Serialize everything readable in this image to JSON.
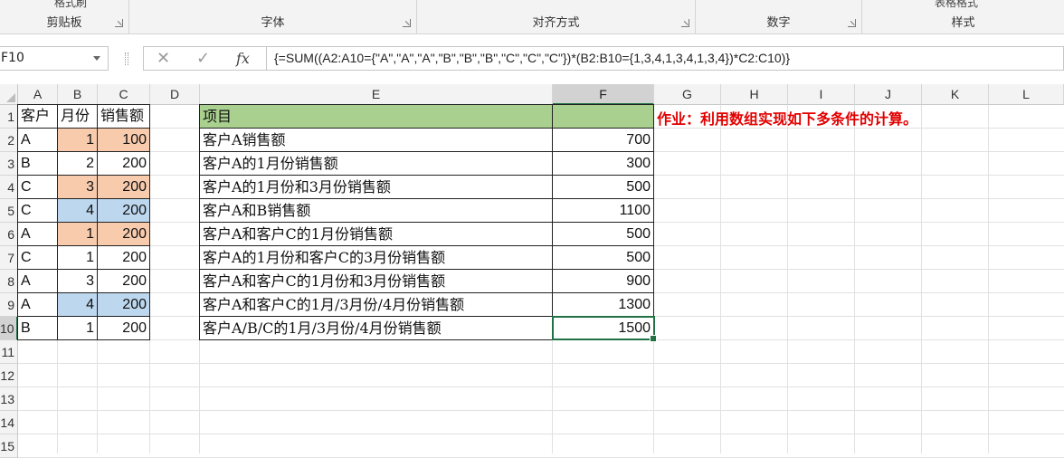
{
  "ribbon": {
    "groups": [
      {
        "label": "剪贴板",
        "top_text": "格式刷"
      },
      {
        "label": "字体"
      },
      {
        "label": "对齐方式"
      },
      {
        "label": "数字"
      },
      {
        "label": "样式",
        "top_text": "表格格式"
      }
    ]
  },
  "formula_bar": {
    "name_box": "F10",
    "cancel_icon": "✕",
    "enter_icon": "✓",
    "fx_label": "fx",
    "formula": "{=SUM((A2:A10={\"A\",\"A\",\"A\",\"B\",\"B\",\"B\",\"C\",\"C\",\"C\"})*(B2:B10={1,3,4,1,3,4,1,3,4})*C2:C10)}"
  },
  "grid": {
    "columns": [
      "A",
      "B",
      "C",
      "D",
      "E",
      "F",
      "G",
      "H",
      "I",
      "J",
      "K",
      "L"
    ],
    "selected_column": "F",
    "rows": [
      "1",
      "2",
      "3",
      "4",
      "5",
      "6",
      "7",
      "8",
      "9",
      "10",
      "11",
      "12",
      "13",
      "14",
      "15"
    ],
    "selected_row": "10"
  },
  "table_left": {
    "headers": [
      "客户",
      "月份",
      "销售额"
    ],
    "rows": [
      {
        "customer": "A",
        "month": "1",
        "sales": "100",
        "month_fill": "orange",
        "sales_fill": "orange"
      },
      {
        "customer": "B",
        "month": "2",
        "sales": "200",
        "month_fill": "",
        "sales_fill": ""
      },
      {
        "customer": "C",
        "month": "3",
        "sales": "200",
        "month_fill": "orange",
        "sales_fill": "orange"
      },
      {
        "customer": "C",
        "month": "4",
        "sales": "200",
        "month_fill": "blue",
        "sales_fill": "blue"
      },
      {
        "customer": "A",
        "month": "1",
        "sales": "200",
        "month_fill": "orange",
        "sales_fill": "orange"
      },
      {
        "customer": "C",
        "month": "1",
        "sales": "200",
        "month_fill": "",
        "sales_fill": ""
      },
      {
        "customer": "A",
        "month": "3",
        "sales": "200",
        "month_fill": "",
        "sales_fill": ""
      },
      {
        "customer": "A",
        "month": "4",
        "sales": "200",
        "month_fill": "blue",
        "sales_fill": "blue"
      },
      {
        "customer": "B",
        "month": "1",
        "sales": "200",
        "month_fill": "",
        "sales_fill": ""
      }
    ]
  },
  "table_right": {
    "header_item": "项目",
    "header_value": "",
    "rows": [
      {
        "item": "客户A销售额",
        "value": "700"
      },
      {
        "item": "客户A的1月份销售额",
        "value": "300"
      },
      {
        "item": "客户A的1月份和3月份销售额",
        "value": "500"
      },
      {
        "item": "客户A和B销售额",
        "value": "1100"
      },
      {
        "item": "客户A和客户C的1月份销售额",
        "value": "500"
      },
      {
        "item": "客户A的1月份和客户C的3月份销售额",
        "value": "500"
      },
      {
        "item": "客户A和客户C的1月份和3月份销售额",
        "value": "900"
      },
      {
        "item": "客户A和客户C的1月/3月份/4月份销售额",
        "value": "1300"
      },
      {
        "item": "客户A/B/C的1月/3月份/4月份销售额",
        "value": "1500"
      }
    ]
  },
  "note": "作业：利用数组实现如下多条件的计算。",
  "colors": {
    "orange": "#f8cbad",
    "blue": "#bdd7ee",
    "green": "#a9d08e",
    "note_red": "#e20000",
    "excel_green": "#217346"
  }
}
